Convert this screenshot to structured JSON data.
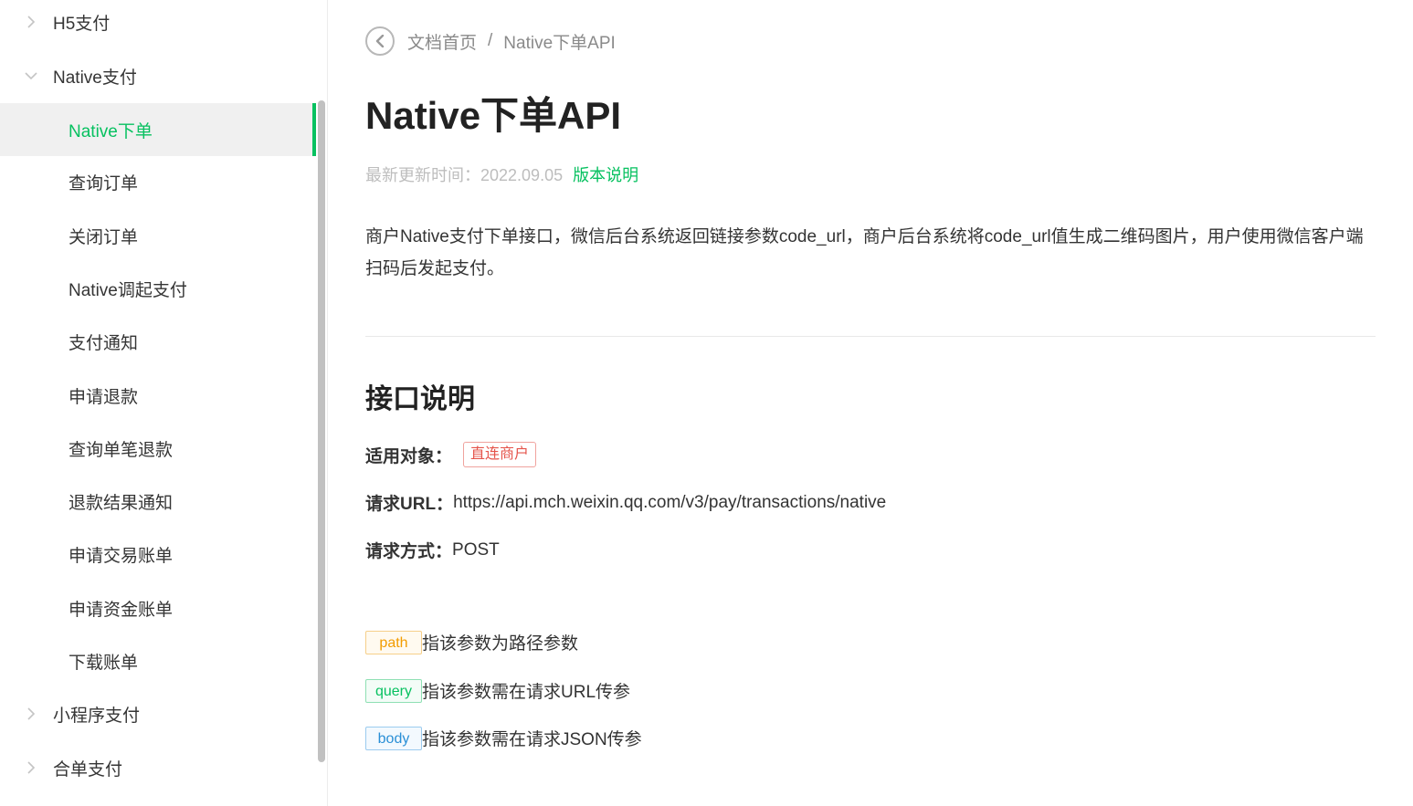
{
  "sidebar": {
    "groups": [
      {
        "label": "H5支付",
        "expanded": false
      },
      {
        "label": "Native支付",
        "expanded": true
      },
      {
        "label": "小程序支付",
        "expanded": false
      },
      {
        "label": "合单支付",
        "expanded": false
      }
    ],
    "items": [
      {
        "label": "Native下单",
        "active": true
      },
      {
        "label": "查询订单"
      },
      {
        "label": "关闭订单"
      },
      {
        "label": "Native调起支付"
      },
      {
        "label": "支付通知"
      },
      {
        "label": "申请退款"
      },
      {
        "label": "查询单笔退款"
      },
      {
        "label": "退款结果通知"
      },
      {
        "label": "申请交易账单"
      },
      {
        "label": "申请资金账单"
      },
      {
        "label": "下载账单"
      }
    ]
  },
  "breadcrumb": {
    "home": "文档首页",
    "separator": "/",
    "current": "Native下单API"
  },
  "page": {
    "title": "Native下单API",
    "updated_label": "最新更新时间：",
    "updated_date": "2022.09.05",
    "version_link": "版本说明",
    "description": "商户Native支付下单接口，微信后台系统返回链接参数code_url，商户后台系统将code_url值生成二维码图片，用户使用微信客户端扫码后发起支付。"
  },
  "api": {
    "section_title": "接口说明",
    "target_label": "适用对象：",
    "target_tag": "直连商户",
    "url_label": "请求URL：",
    "url_value": "https://api.mch.weixin.qq.com/v3/pay/transactions/native",
    "method_label": "请求方式：",
    "method_value": "POST"
  },
  "legend": [
    {
      "tag": "path",
      "text": "指该参数为路径参数"
    },
    {
      "tag": "query",
      "text": "指该参数需在请求URL传参"
    },
    {
      "tag": "body",
      "text": "指该参数需在请求JSON传参"
    }
  ],
  "colors": {
    "accent": "#07c160",
    "path": "#f29c00",
    "body": "#2a8fd6",
    "tag_red": "#e5544b"
  }
}
